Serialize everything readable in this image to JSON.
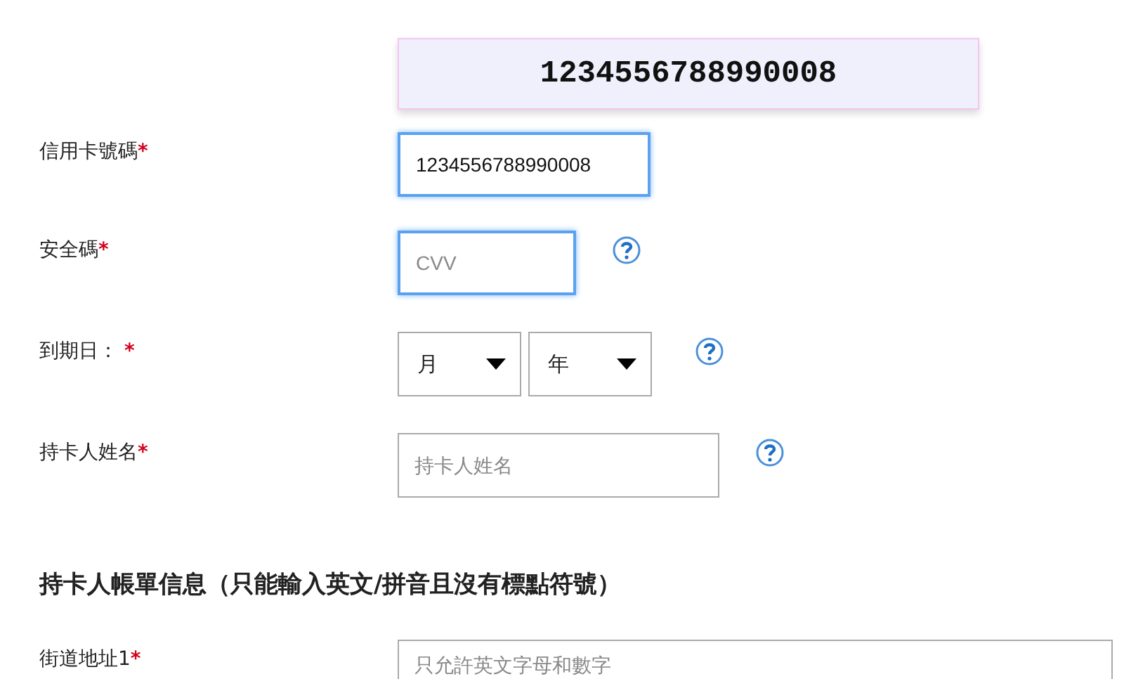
{
  "card_preview": {
    "number": "1234556788990008"
  },
  "fields": [
    {
      "kind": "text",
      "label": "信用卡號碼",
      "required_mark": "*",
      "value": "1234556788990008",
      "focused": true,
      "help": false
    },
    {
      "kind": "text",
      "label": "安全碼",
      "required_mark": "*",
      "placeholder": "CVV",
      "focused": true,
      "help": true
    },
    {
      "kind": "select_pair",
      "label": "到期日：",
      "required_mark": "*",
      "selects": [
        {
          "value": "月"
        },
        {
          "value": "年"
        }
      ],
      "help": true
    },
    {
      "kind": "text",
      "label": "持卡人姓名",
      "required_mark": "*",
      "placeholder": "持卡人姓名",
      "focused": false,
      "help": true
    }
  ],
  "billing": {
    "heading": "持卡人帳單信息（只能輸入英文/拼音且沒有標點符號）",
    "fields": [
      {
        "kind": "text",
        "label": "街道地址1",
        "required_mark": "*",
        "placeholder": "只允許英文字母和數字",
        "focused": false,
        "help": false
      }
    ]
  }
}
